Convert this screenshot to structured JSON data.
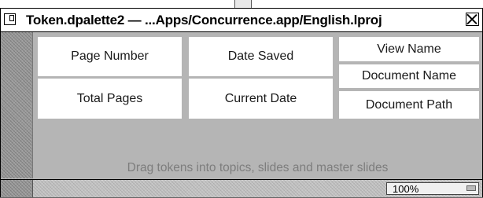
{
  "window": {
    "title": "Token.dpalette2 — ...Apps/Concurrence.app/English.lproj",
    "menu_icon": "window-menu-icon",
    "close_icon": "close-icon"
  },
  "tokens": {
    "page_number": "Page Number",
    "date_saved": "Date Saved",
    "view_name": "View Name",
    "total_pages": "Total Pages",
    "current_date": "Current Date",
    "document_name": "Document Name",
    "document_path": "Document Path"
  },
  "hint": "Drag tokens into topics, slides and master slides",
  "status_bar": {
    "zoom_value": "100%"
  }
}
